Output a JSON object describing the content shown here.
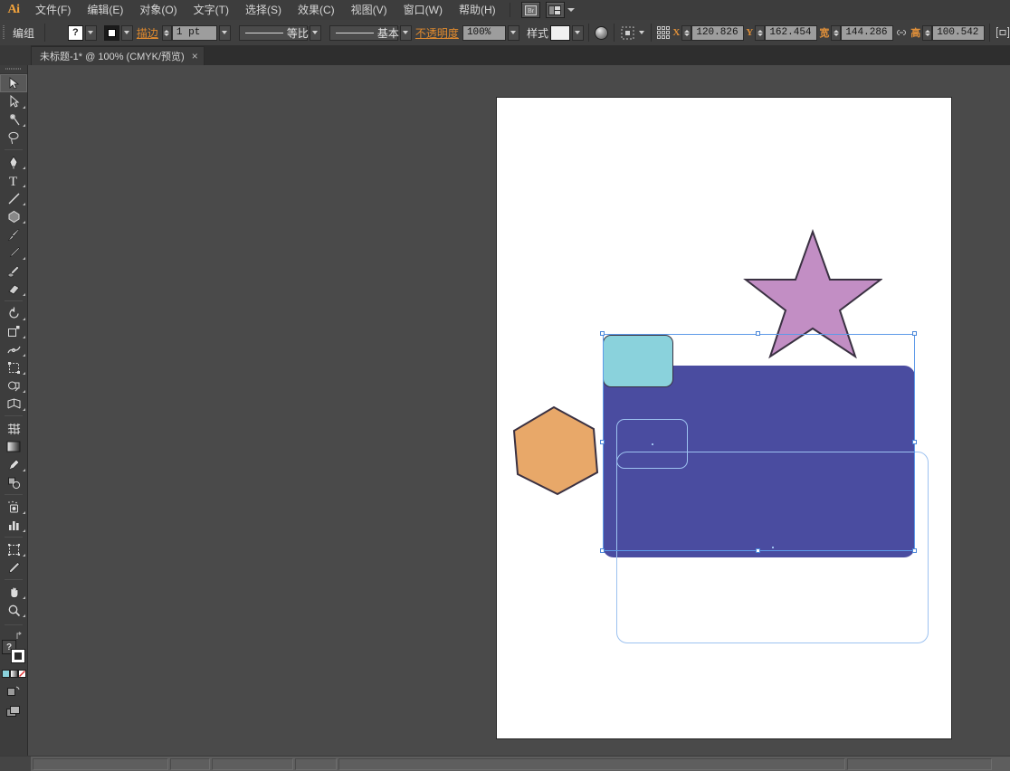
{
  "app": {
    "logo": "Ai",
    "title": "Adobe Illustrator"
  },
  "menubar": {
    "items": [
      {
        "label": "文件(F)",
        "name": "menu-file"
      },
      {
        "label": "编辑(E)",
        "name": "menu-edit"
      },
      {
        "label": "对象(O)",
        "name": "menu-object"
      },
      {
        "label": "文字(T)",
        "name": "menu-type"
      },
      {
        "label": "选择(S)",
        "name": "menu-select"
      },
      {
        "label": "效果(C)",
        "name": "menu-effect"
      },
      {
        "label": "视图(V)",
        "name": "menu-view"
      },
      {
        "label": "窗口(W)",
        "name": "menu-window"
      },
      {
        "label": "帮助(H)",
        "name": "menu-help"
      }
    ],
    "bridge_icon": "bridge-icon",
    "arrange_icon": "arrange-documents-icon"
  },
  "controlbar": {
    "selection_label": "编组",
    "fill_swatch_value": "?",
    "stroke_label": "描边",
    "stroke_weight": "1 pt",
    "stroke_profile": "等比",
    "brush_definition": "基本",
    "opacity_label": "不透明度",
    "opacity_value": "100%",
    "style_label": "样式",
    "transform_x_label": "X",
    "transform_x_value": "120.826",
    "transform_y_label": "Y",
    "transform_y_value": "162.454",
    "transform_w_label": "宽",
    "transform_w_value": "144.286",
    "transform_h_label": "高",
    "transform_h_value": "100.542",
    "icons": {
      "opacity_preview": "opacity-round-icon",
      "align": "align-icon",
      "transform_grid": "transform-reference-point-icon",
      "lock_ratio": "link-constrain-icon",
      "isolate": "isolate-selection-icon"
    }
  },
  "tabbar": {
    "tabs": [
      {
        "label": "未标题-1* @ 100% (CMYK/预览)",
        "close": "×",
        "active": true
      }
    ]
  },
  "toolbar": {
    "tools": [
      {
        "name": "selection-tool",
        "label": "选择工具",
        "active": true
      },
      {
        "name": "direct-selection-tool",
        "label": "直接选择工具",
        "active": false
      },
      {
        "name": "magic-wand-tool",
        "label": "魔棒工具",
        "active": false
      },
      {
        "name": "lasso-tool",
        "label": "套索工具",
        "active": false
      },
      {
        "name": "pen-tool",
        "label": "钢笔工具",
        "active": false
      },
      {
        "name": "type-tool",
        "label": "文字工具",
        "active": false
      },
      {
        "name": "line-segment-tool",
        "label": "直线段工具",
        "active": false
      },
      {
        "name": "polygon-shape-tool",
        "label": "多边形工具",
        "active": false
      },
      {
        "name": "paintbrush-tool",
        "label": "画笔工具",
        "active": false
      },
      {
        "name": "pencil-tool",
        "label": "铅笔工具",
        "active": false
      },
      {
        "name": "blob-brush-tool",
        "label": "斑点画笔工具",
        "active": false
      },
      {
        "name": "eraser-tool",
        "label": "橡皮擦工具",
        "active": false
      },
      {
        "name": "rotate-tool",
        "label": "旋转工具",
        "active": false
      },
      {
        "name": "scale-tool",
        "label": "比例缩放工具",
        "active": false
      },
      {
        "name": "width-warp-tool",
        "label": "变形工具",
        "active": false
      },
      {
        "name": "free-transform-tool",
        "label": "自由变换工具",
        "active": false
      },
      {
        "name": "shape-builder-tool",
        "label": "形状生成器工具",
        "active": false
      },
      {
        "name": "perspective-grid-tool",
        "label": "透视网格工具",
        "active": false
      },
      {
        "name": "mesh-tool",
        "label": "网格工具",
        "active": false
      },
      {
        "name": "gradient-tool",
        "label": "渐变工具",
        "active": false
      },
      {
        "name": "eyedropper-tool",
        "label": "吸管工具",
        "active": false
      },
      {
        "name": "blend-tool",
        "label": "混合工具",
        "active": false
      },
      {
        "name": "symbol-sprayer-tool",
        "label": "符号喷枪工具",
        "active": false
      },
      {
        "name": "column-graph-tool",
        "label": "柱形图工具",
        "active": false
      },
      {
        "name": "artboard-tool",
        "label": "画板工具",
        "active": false
      },
      {
        "name": "slice-tool",
        "label": "切片工具",
        "active": false
      },
      {
        "name": "hand-tool",
        "label": "抓手工具",
        "active": false
      },
      {
        "name": "zoom-tool",
        "label": "缩放工具",
        "active": false
      }
    ],
    "fill_label": "?",
    "swap_icon": "swap-fill-stroke-icon",
    "default_icon": "default-fill-stroke-icon",
    "color_modes": [
      "color-mode-swatch",
      "gradient-mode-swatch",
      "none-mode-swatch"
    ],
    "drawing_mode_icon": "drawing-mode-icon",
    "screen_mode_icon": "screen-mode-icon"
  },
  "canvas": {
    "background_color": "#4a4a4a",
    "artboard_color": "#ffffff",
    "shapes": [
      {
        "name": "star-shape",
        "fill": "#c28ec4",
        "stroke": "#3a3142",
        "label": "星形"
      },
      {
        "name": "hexagon-shape",
        "fill": "#e8a869",
        "stroke": "#3a3142",
        "label": "六边形"
      },
      {
        "name": "teal-rounded-rect",
        "fill": "#8ad2dc",
        "stroke": "#3a3142",
        "label": "圆角矩形 青"
      },
      {
        "name": "indigo-rounded-rect",
        "fill": "#4a4ca0",
        "stroke": "#2b2b60",
        "label": "圆角矩形 靛蓝"
      },
      {
        "name": "outline-rect-small",
        "fill": "none",
        "stroke": "#9dc2f0",
        "label": "路径轮廓 小"
      },
      {
        "name": "outline-rect-large",
        "fill": "none",
        "stroke": "#9dc2f0",
        "label": "路径轮廓 大"
      }
    ],
    "selection": {
      "color": "#5d9ae8",
      "handle_fill": "#ffffff",
      "handle_border": "#4a86d8"
    }
  },
  "taskbar": {
    "segments": 6
  }
}
